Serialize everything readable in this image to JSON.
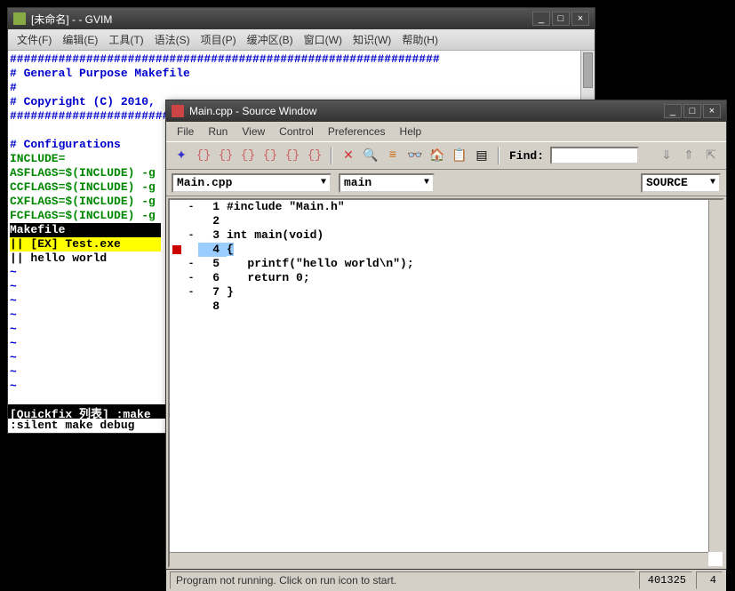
{
  "gvim": {
    "title": "[未命名] - - GVIM",
    "menu": [
      "文件(F)",
      "编辑(E)",
      "工具(T)",
      "语法(S)",
      "项目(P)",
      "缓冲区(B)",
      "窗口(W)",
      "知识(W)",
      "帮助(H)"
    ],
    "lines": {
      "hashdiv": "##############################################################",
      "gpm": "# General Purpose Makefile",
      "blank": "#",
      "copyright": "# Copyright (C) 2010,",
      "config": "# Configurations",
      "include": "INCLUDE=",
      "asflags": "ASFLAGS=$(INCLUDE) -g",
      "ccflags": "CCFLAGS=$(INCLUDE) -g",
      "cxflags": "CXFLAGS=$(INCLUDE) -g",
      "fcflags": "FCFLAGS=$(INCLUDE) -g",
      "makefile": "Makefile",
      "ex_test": "|| [EX] Test.exe",
      "hello": "|| hello world"
    },
    "status": "[Quickfix 列表] :make",
    "cmdline": ":silent make debug"
  },
  "source_window": {
    "title": "Main.cpp - Source Window",
    "menu": [
      "File",
      "Run",
      "View",
      "Control",
      "Preferences",
      "Help"
    ],
    "find_label": "Find:",
    "find_value": "",
    "selectors": {
      "file": "Main.cpp",
      "func": "main",
      "mode": "SOURCE"
    },
    "code": [
      {
        "lno": "1",
        "text": "#include \"Main.h\"",
        "gutter": "-",
        "bp": false,
        "cur": false
      },
      {
        "lno": "2",
        "text": "",
        "gutter": "",
        "bp": false,
        "cur": false
      },
      {
        "lno": "3",
        "text": "int main(void)",
        "gutter": "-",
        "bp": false,
        "cur": false
      },
      {
        "lno": "4",
        "text": "{",
        "gutter": "",
        "bp": true,
        "cur": true
      },
      {
        "lno": "5",
        "text": "   printf(\"hello world\\n\");",
        "gutter": "-",
        "bp": false,
        "cur": false
      },
      {
        "lno": "6",
        "text": "   return 0;",
        "gutter": "-",
        "bp": false,
        "cur": false
      },
      {
        "lno": "7",
        "text": "}",
        "gutter": "-",
        "bp": false,
        "cur": false
      },
      {
        "lno": "8",
        "text": "",
        "gutter": "",
        "bp": false,
        "cur": false
      }
    ],
    "status": {
      "msg": "Program not running. Click on run icon to start.",
      "num1": "401325",
      "num2": "4"
    },
    "toolbar_icons": [
      "run-icon",
      "step-icon",
      "next-icon",
      "finish-icon",
      "continue-icon",
      "step-asm-icon",
      "next-asm-icon",
      "register-icon",
      "memory-icon",
      "stack-icon",
      "watch-icon",
      "locals-icon",
      "breakpoints-icon",
      "console-icon",
      "down-icon",
      "up-icon",
      "home-icon"
    ]
  }
}
